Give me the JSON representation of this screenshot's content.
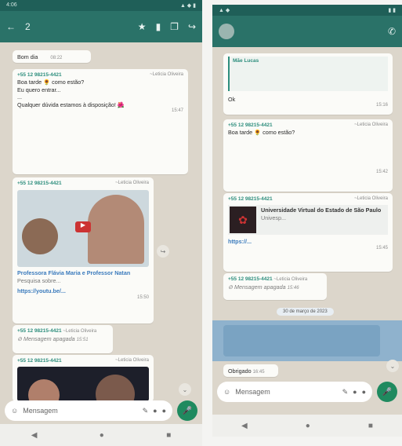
{
  "left": {
    "status": {
      "left": "4:06",
      "right": ""
    },
    "appbar": {
      "count": "2"
    },
    "first_message": {
      "text": "Bom dia",
      "time": "08:22"
    },
    "message1": {
      "sender": "+55 12 98215-4421",
      "tag": "~Leticia Oliveira",
      "lines": [
        "Boa tarde 🌻 como estão?",
        "Eu quero entrar...",
        "...",
        "Qualquer dúvida estamos à disposição! 🌺"
      ],
      "time": "15:47"
    },
    "message2": {
      "sender": "+55 12 98215-4421",
      "tag": "~Leticia Oliveira",
      "link_title": "Professora Flávia Maria e Professor Natan",
      "link_desc": "Pesquisa sobre...",
      "url": "https://youtu.be/...",
      "time": "15:50"
    },
    "message3": {
      "sender": "+55 12 98215-4421",
      "tag": "~Leticia Oliveira",
      "text": "Mensagem apagada",
      "time": "15:51"
    },
    "message4": {
      "sender": "+55 12 98215-4421",
      "tag": "~Leticia Oliveira"
    },
    "input_placeholder": "Mensagem"
  },
  "right": {
    "quoted": {
      "sender": "Mãe Lucas",
      "text": "Ok",
      "time": "15:16"
    },
    "message1": {
      "sender": "+55 12 98215-4421",
      "tag": "~Leticia Oliveira",
      "text": "Boa tarde 🌻 como estão?",
      "time": "15:42"
    },
    "message2": {
      "sender": "+55 12 98215-4421",
      "tag": "~Leticia Oliveira",
      "link_title": "Universidade Virtual do Estado de São Paulo",
      "link_desc": "Univesp...",
      "url": "https://...",
      "time": "15:45"
    },
    "message3": {
      "sender": "+55 12 98215-4421",
      "tag": "~Leticia Oliveira",
      "text": "Mensagem apagada",
      "time": "15:46"
    },
    "date_pill": "30 de março de 2023",
    "last_msg": {
      "text": "Obrigado",
      "time": "16:45"
    },
    "input_placeholder": "Mensagem"
  },
  "colors": {
    "header": "#2a7268",
    "bubble": "#fbfbf8",
    "chat_bg": "#dcd6cb",
    "accent": "#1f8a5f"
  }
}
